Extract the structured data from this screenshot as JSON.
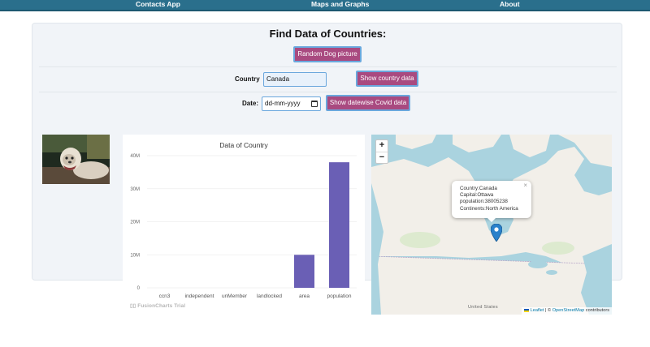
{
  "nav": {
    "items": [
      {
        "label": "Contacts App"
      },
      {
        "label": "Maps and Graphs"
      },
      {
        "label": "About"
      }
    ]
  },
  "page": {
    "title": "Find Data of Countries:",
    "random_dog_label": "Random Dog picture",
    "country_label": "Country",
    "country_value": "Canada",
    "show_country_label": "Show country data",
    "date_label": "Date:",
    "date_placeholder": "dd-mm-yyyy",
    "show_covid_label": "Show datewise Covid data"
  },
  "chart_data": {
    "type": "bar",
    "title": "Data of Country",
    "categories": [
      "ccn3",
      "independent",
      "unMember",
      "landlocked",
      "area",
      "population"
    ],
    "values": [
      124,
      1,
      1,
      0,
      9984670,
      38005238
    ],
    "ylim": [
      0,
      40000000
    ],
    "yticks": [
      0,
      10000000,
      20000000,
      30000000,
      40000000
    ],
    "ytick_labels": [
      "0",
      "10M",
      "20M",
      "30M",
      "40M"
    ],
    "bar_color": "#6a5fb5",
    "grid": true,
    "watermark": "FusionCharts Trial"
  },
  "map": {
    "zoom_in": "+",
    "zoom_out": "−",
    "popup": {
      "country": "Country:Canada",
      "capital": "Capital:Ottawa",
      "population": "population:38005238",
      "continents": "Continents:North America"
    },
    "us_label": "United States",
    "attribution_leaflet": "Leaflet",
    "attribution_osm": "OpenStreetMap",
    "attribution_suffix": "contributors",
    "attribution_sep": "| ©",
    "marker_color": "#2a81cb"
  }
}
